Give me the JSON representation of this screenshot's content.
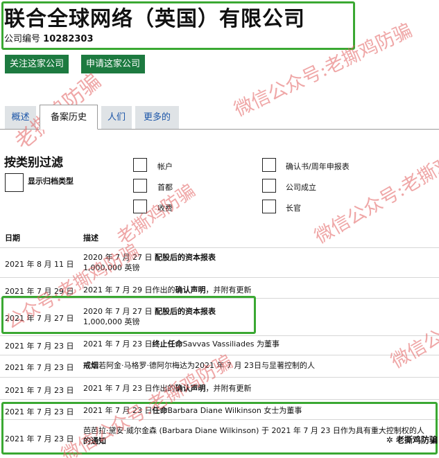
{
  "header": {
    "company_name": "联合全球网络（英国）有限公司",
    "number_label": "公司编号",
    "number_value": "10282303"
  },
  "actions": {
    "follow": "关注这家公司",
    "apply": "申请这家公司"
  },
  "tabs": [
    {
      "label": "概述"
    },
    {
      "label": "备案历史"
    },
    {
      "label": "人们"
    },
    {
      "label": "更多的"
    }
  ],
  "filter": {
    "title": "按类别过滤",
    "show_archive": "显示归档类型",
    "options": [
      "帐户",
      "首都",
      "收费",
      "确认书/周年申报表",
      "公司成立",
      "长官"
    ]
  },
  "table": {
    "col_date": "日期",
    "col_desc": "描述",
    "rows": [
      {
        "date": "2021 年 8 月 11 日",
        "pre": "2020 年 7 月 27 日 ",
        "bold": "配股后的资本报表",
        "post": "",
        "line2": "1,000,000 英镑"
      },
      {
        "date": "2021 年 7 月 29 日",
        "pre": "2021 年 7 月 29 日作出的",
        "bold": "确认声明",
        "post": "，并附有更新",
        "line2": ""
      },
      {
        "date": "2021 年 7 月 27 日",
        "pre": "2020 年 7 月 27 日 ",
        "bold": "配股后的资本报表",
        "post": "",
        "line2": "1,000,000 英镑"
      },
      {
        "date": "2021 年 7 月 23 日",
        "pre": "2021 年 7 月 23 日",
        "bold": "终止任命",
        "post": "Savvas Vassiliades 为董事",
        "line2": ""
      },
      {
        "date": "2021 年 7 月 23 日",
        "pre": "",
        "bold": "戒烟",
        "post": "若阿金·马格罗·德阿尔梅达为2021 年 7 月 23日与显著控制的人",
        "line2": ""
      },
      {
        "date": "2021 年 7 月 23 日",
        "pre": "2021 年 7 月 23 日作出的",
        "bold": "确认声明",
        "post": "，并附有更新",
        "line2": ""
      },
      {
        "date": "2021 年 7 月 23 日",
        "pre": "2021 年 7 月 23 日",
        "bold": "任命",
        "post": "Barbara Diane Wilkinson 女士为董事",
        "line2": ""
      },
      {
        "date": "2021 年 7 月 23 日",
        "pre": "芭芭拉·黛安·威尔金森 (Barbara Diane Wilkinson) 于 2021 年 7 月 23 日作为具有重大控制权的人",
        "bold": "",
        "post": "",
        "line2": "的通知"
      }
    ]
  },
  "watermarks": [
    "微信公众号:老撕鸡防骗",
    "老撕鸡防骗",
    "微信公众号:老撕鸡防骗",
    "微信公众号:老撕鸡防骗",
    "老撕鸡防骗",
    "公众号:老撕鸡防骗",
    "微信公"
  ],
  "logo": "老撕鸡防骗",
  "colors": {
    "button_green": "#1d7a40",
    "highlight_green": "#3aa832",
    "watermark_red": "#e36060",
    "tab_link": "#1b55a8"
  }
}
